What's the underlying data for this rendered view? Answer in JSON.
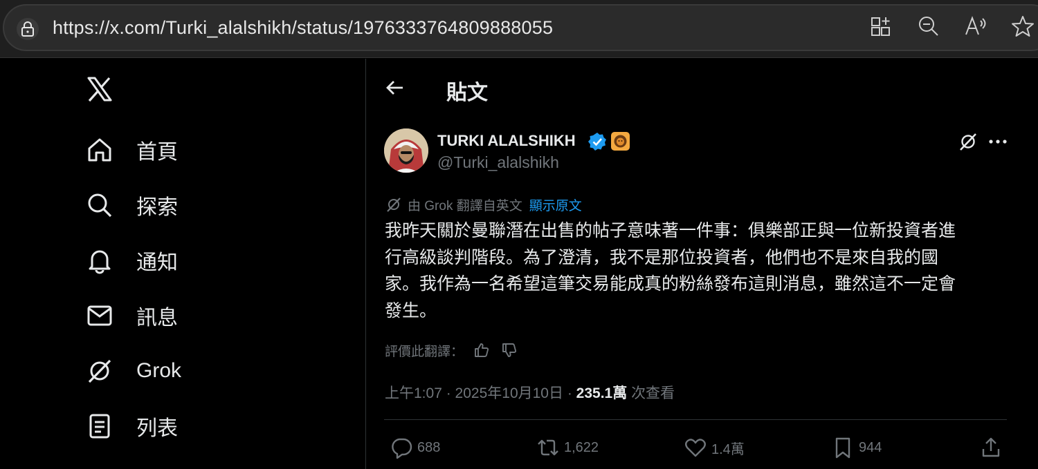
{
  "browser": {
    "url": "https://x.com/Turki_alalshikh/status/1976333764809888055",
    "icons": [
      "lock-icon",
      "split-screen-icon",
      "zoom-out-icon",
      "read-aloud-icon",
      "favorite-star-icon"
    ]
  },
  "sidebar": {
    "logo": "x-logo-icon",
    "items": [
      {
        "label": "首頁",
        "icon": "home-icon"
      },
      {
        "label": "探索",
        "icon": "search-icon"
      },
      {
        "label": "通知",
        "icon": "bell-icon"
      },
      {
        "label": "訊息",
        "icon": "mail-icon"
      },
      {
        "label": "Grok",
        "icon": "grok-icon"
      },
      {
        "label": "列表",
        "icon": "list-icon"
      }
    ]
  },
  "header": {
    "title": "貼文"
  },
  "tweet": {
    "author_name": "TURKI ALALSHIKH",
    "handle": "@Turki_alalshikh",
    "translation_note": "由 Grok 翻譯自英文",
    "show_original": "顯示原文",
    "lines": [
      "我昨天關於曼聯潛在出售的帖子意味著一件事：俱樂部正與一位新投資者進",
      "行高級談判階段。為了澄清，我不是那位投資者，他們也不是來自我的國",
      "家。我作為一名希望這筆交易能成真的粉絲發布這則消息，雖然這不一定會",
      "發生。"
    ],
    "rate_label": "評價此翻譯：",
    "time": "上午1:07",
    "date": "2025年10月10日",
    "views": "235.1萬",
    "views_label": "次查看",
    "separator": "·"
  },
  "actions": {
    "replies": "688",
    "reposts": "1,622",
    "likes": "1.4萬",
    "bookmarks": "944"
  },
  "colors": {
    "background": "#000000",
    "text": "#e7e9ea",
    "muted": "#71767b",
    "accent": "#1d9bf0",
    "divider": "#2f3336"
  }
}
